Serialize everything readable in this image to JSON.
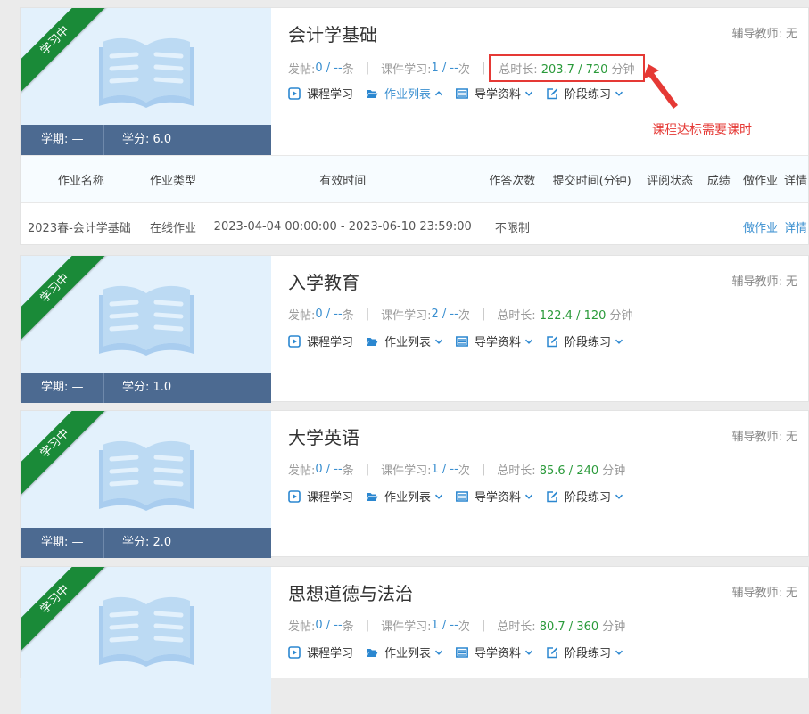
{
  "annotation": "课程达标需要课时",
  "colors": {
    "ribbon": "#1a8a38",
    "meta_bar": "#4c6a91",
    "accent_blue": "#3a8fd0",
    "green_value": "#2a9a3a",
    "annotation_red": "#e53935"
  },
  "courses": [
    {
      "status": "学习中",
      "title": "会计学基础",
      "tutor": "辅导教师: 无",
      "term": "学期: —",
      "credit": "学分: 6.0",
      "posts_label": "发帖: ",
      "posts_value": "0 / --",
      "posts_unit": " 条",
      "courseware_label": "课件学习: ",
      "courseware_value": "1 / --",
      "courseware_unit": " 次",
      "duration_label": "总时长: ",
      "duration_value": "203.7 / 720",
      "duration_unit": " 分钟",
      "actions": {
        "study": "课程学习",
        "homework": "作业列表",
        "guide": "导学资料",
        "practice": "阶段练习"
      },
      "homework_table": {
        "headers": [
          "作业名称",
          "作业类型",
          "有效时间",
          "作答次数",
          "提交时间(分钟)",
          "评阅状态",
          "成绩",
          "做作业",
          "详情"
        ],
        "rows": [
          {
            "name": "2023春-会计学基础",
            "type": "在线作业",
            "valid_time": "2023-04-04 00:00:00 - 2023-06-10 23:59:00",
            "attempts": "不限制",
            "submit_time": "",
            "review_status": "",
            "score": "",
            "do_homework": "做作业",
            "details": "详情"
          }
        ]
      }
    },
    {
      "status": "学习中",
      "title": "入学教育",
      "tutor": "辅导教师: 无",
      "term": "学期: —",
      "credit": "学分: 1.0",
      "posts_label": "发帖: ",
      "posts_value": "0 / --",
      "posts_unit": " 条",
      "courseware_label": "课件学习: ",
      "courseware_value": "2 / --",
      "courseware_unit": " 次",
      "duration_label": "总时长: ",
      "duration_value": "122.4 / 120",
      "duration_unit": " 分钟",
      "actions": {
        "study": "课程学习",
        "homework": "作业列表",
        "guide": "导学资料",
        "practice": "阶段练习"
      }
    },
    {
      "status": "学习中",
      "title": "大学英语",
      "tutor": "辅导教师: 无",
      "term": "学期: —",
      "credit": "学分: 2.0",
      "posts_label": "发帖: ",
      "posts_value": "0 / --",
      "posts_unit": " 条",
      "courseware_label": "课件学习: ",
      "courseware_value": "1 / --",
      "courseware_unit": " 次",
      "duration_label": "总时长: ",
      "duration_value": "85.6 / 240",
      "duration_unit": " 分钟",
      "actions": {
        "study": "课程学习",
        "homework": "作业列表",
        "guide": "导学资料",
        "practice": "阶段练习"
      }
    },
    {
      "status": "学习中",
      "title": "思想道德与法治",
      "tutor": "辅导教师: 无",
      "term": "学期: —",
      "credit": "学分: 2.0",
      "posts_label": "发帖: ",
      "posts_value": "0 / --",
      "posts_unit": " 条",
      "courseware_label": "课件学习: ",
      "courseware_value": "1 / --",
      "courseware_unit": " 次",
      "duration_label": "总时长: ",
      "duration_value": "80.7 / 360",
      "duration_unit": " 分钟",
      "actions": {
        "study": "课程学习",
        "homework": "作业列表",
        "guide": "导学资料",
        "practice": "阶段练习"
      }
    }
  ]
}
